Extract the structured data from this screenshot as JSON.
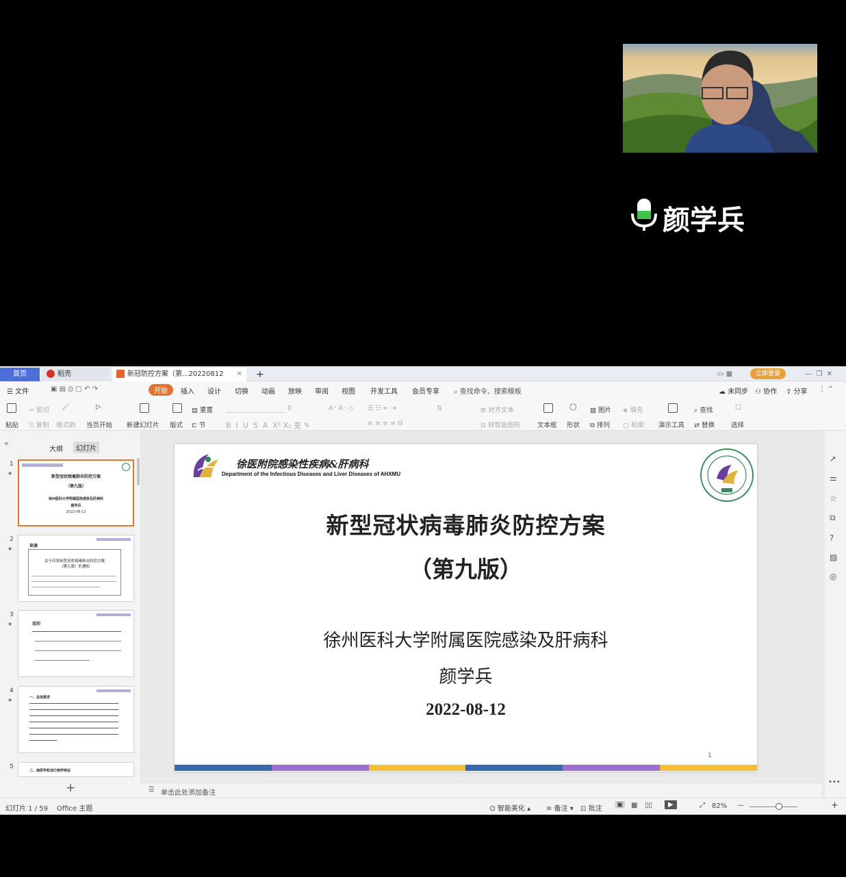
{
  "speaker_name": "颜学兵",
  "tabs": {
    "home": "首页",
    "wps": "稻壳",
    "doc": "新冠防控方案（第...20220812",
    "login": "立即登录"
  },
  "menu": [
    "文件",
    "开始",
    "插入",
    "设计",
    "切换",
    "动画",
    "放映",
    "审阅",
    "视图",
    "开发工具",
    "会员专享"
  ],
  "search_placeholder": "查找命令、搜索模板",
  "menu_right": {
    "sync": "未同步",
    "collab": "协作",
    "share": "分享"
  },
  "ribbon": {
    "paste": "粘贴",
    "cut": "剪切",
    "copy": "复制",
    "format_painter": "格式刷",
    "from_current": "当页开始",
    "new_slide": "新建幻灯片",
    "layout": "版式",
    "section": "节",
    "reset": "重置",
    "font_size": "0",
    "align_text": "对齐文本",
    "smart_art": "转智能图形",
    "textbox": "文本框",
    "shape": "形状",
    "picture": "图片",
    "arrange": "排列",
    "fill": "填充",
    "outline": "轮廓",
    "present_tools": "演示工具",
    "find": "查找",
    "replace": "替换",
    "select": "选择"
  },
  "panel_tabs": {
    "outline": "大纲",
    "slides": "幻灯片"
  },
  "thumbs": [
    {
      "num": "1",
      "lines": [
        "新型冠状病毒肺炎防控方案",
        "（第九版）",
        "徐州医科大学附属医院感染及肝病科",
        "颜学兵",
        "2022-08-12"
      ]
    },
    {
      "num": "2",
      "lines": [
        "来源",
        "关于印发新型冠状病毒肺炎防控方案",
        "（第九版）的通知"
      ]
    },
    {
      "num": "3",
      "lines": [
        "目的"
      ]
    },
    {
      "num": "4",
      "lines": [
        "一、总体要求"
      ]
    },
    {
      "num": "5",
      "lines": [
        "二、病原学和流行病学特征"
      ]
    }
  ],
  "slide": {
    "dept_cn": "徐医附院感染性疾病&肝病科",
    "dept_en": "Department of the Infectious Diseases and Liver Diseases of AHXMU",
    "title": "新型冠状病毒肺炎防控方案",
    "edition": "（第九版）",
    "org": "徐州医科大学附属医院感染及肝病科",
    "author": "颜学兵",
    "date": "2022-08-12",
    "page_no": "1",
    "bar_colors": [
      "#3a66b3",
      "#9b6fd0",
      "#f2c037",
      "#3a66b3",
      "#9b6fd0",
      "#f2c037"
    ]
  },
  "notes_placeholder": "单击此处添加备注",
  "status": {
    "slide_info": "幻灯片 1 / 59",
    "theme": "Office 主题",
    "beautify": "智能美化",
    "notes": "备注",
    "comment": "批注",
    "zoom": "82%"
  }
}
